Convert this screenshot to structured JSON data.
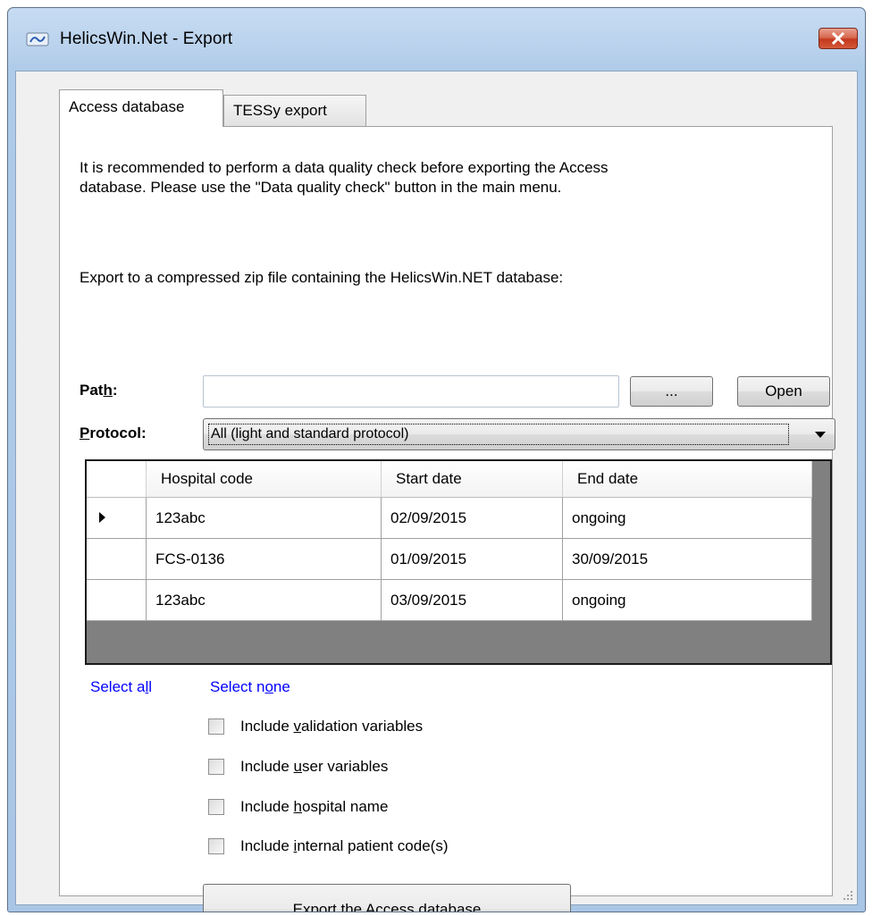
{
  "window": {
    "title": "HelicsWin.Net - Export",
    "close_glyph": "✕"
  },
  "tabs": [
    {
      "label": "Access database",
      "active": true
    },
    {
      "label": "TESSy export",
      "active": false
    }
  ],
  "info": {
    "line1": "It is recommended to perform a data quality check before exporting the Access",
    "line2": "database. Please use the \"Data quality check\" button in the main menu."
  },
  "export_description": "Export to a compressed zip file containing the HelicsWin.NET database:",
  "path": {
    "label_pre": "Pat",
    "label_u": "h",
    "label_post": ":",
    "value": "",
    "browse_label": "...",
    "open_label": "Open"
  },
  "protocol": {
    "label_u": "P",
    "label_post": "rotocol:",
    "selected": "All (light and standard protocol)"
  },
  "grid": {
    "columns": [
      "Hospital code",
      "Start date",
      "End date"
    ],
    "rows": [
      {
        "hospital_code": "123abc",
        "start_date": "02/09/2015",
        "end_date": "ongoing",
        "current": true
      },
      {
        "hospital_code": "FCS-0136",
        "start_date": "01/09/2015",
        "end_date": "30/09/2015",
        "current": false
      },
      {
        "hospital_code": "123abc",
        "start_date": "03/09/2015",
        "end_date": "ongoing",
        "current": false
      }
    ]
  },
  "links": {
    "select_all_pre": "Select a",
    "select_all_u": "l",
    "select_all_post": "l",
    "select_none_pre": "Select n",
    "select_none_u": "o",
    "select_none_post": "ne"
  },
  "options": [
    {
      "pre": "Include ",
      "u": "v",
      "post": "alidation variables",
      "checked": false
    },
    {
      "pre": "Include ",
      "u": "u",
      "post": "ser variables",
      "checked": false
    },
    {
      "pre": "Include ",
      "u": "h",
      "post": "ospital name",
      "checked": false
    },
    {
      "pre": "Include ",
      "u": "i",
      "post": "nternal patient code(s)",
      "checked": false
    }
  ],
  "export_button": {
    "pre": "Export the ",
    "u": "A",
    "post": "ccess database"
  },
  "colors": {
    "link": "#0000ff",
    "title_bar": "#b9d1ec",
    "close_button": "#c4381d",
    "grid_background": "#808080"
  },
  "icons": [
    "app-icon",
    "close-icon",
    "dropdown-arrow-icon",
    "row-indicator-icon",
    "resize-grip-icon"
  ]
}
